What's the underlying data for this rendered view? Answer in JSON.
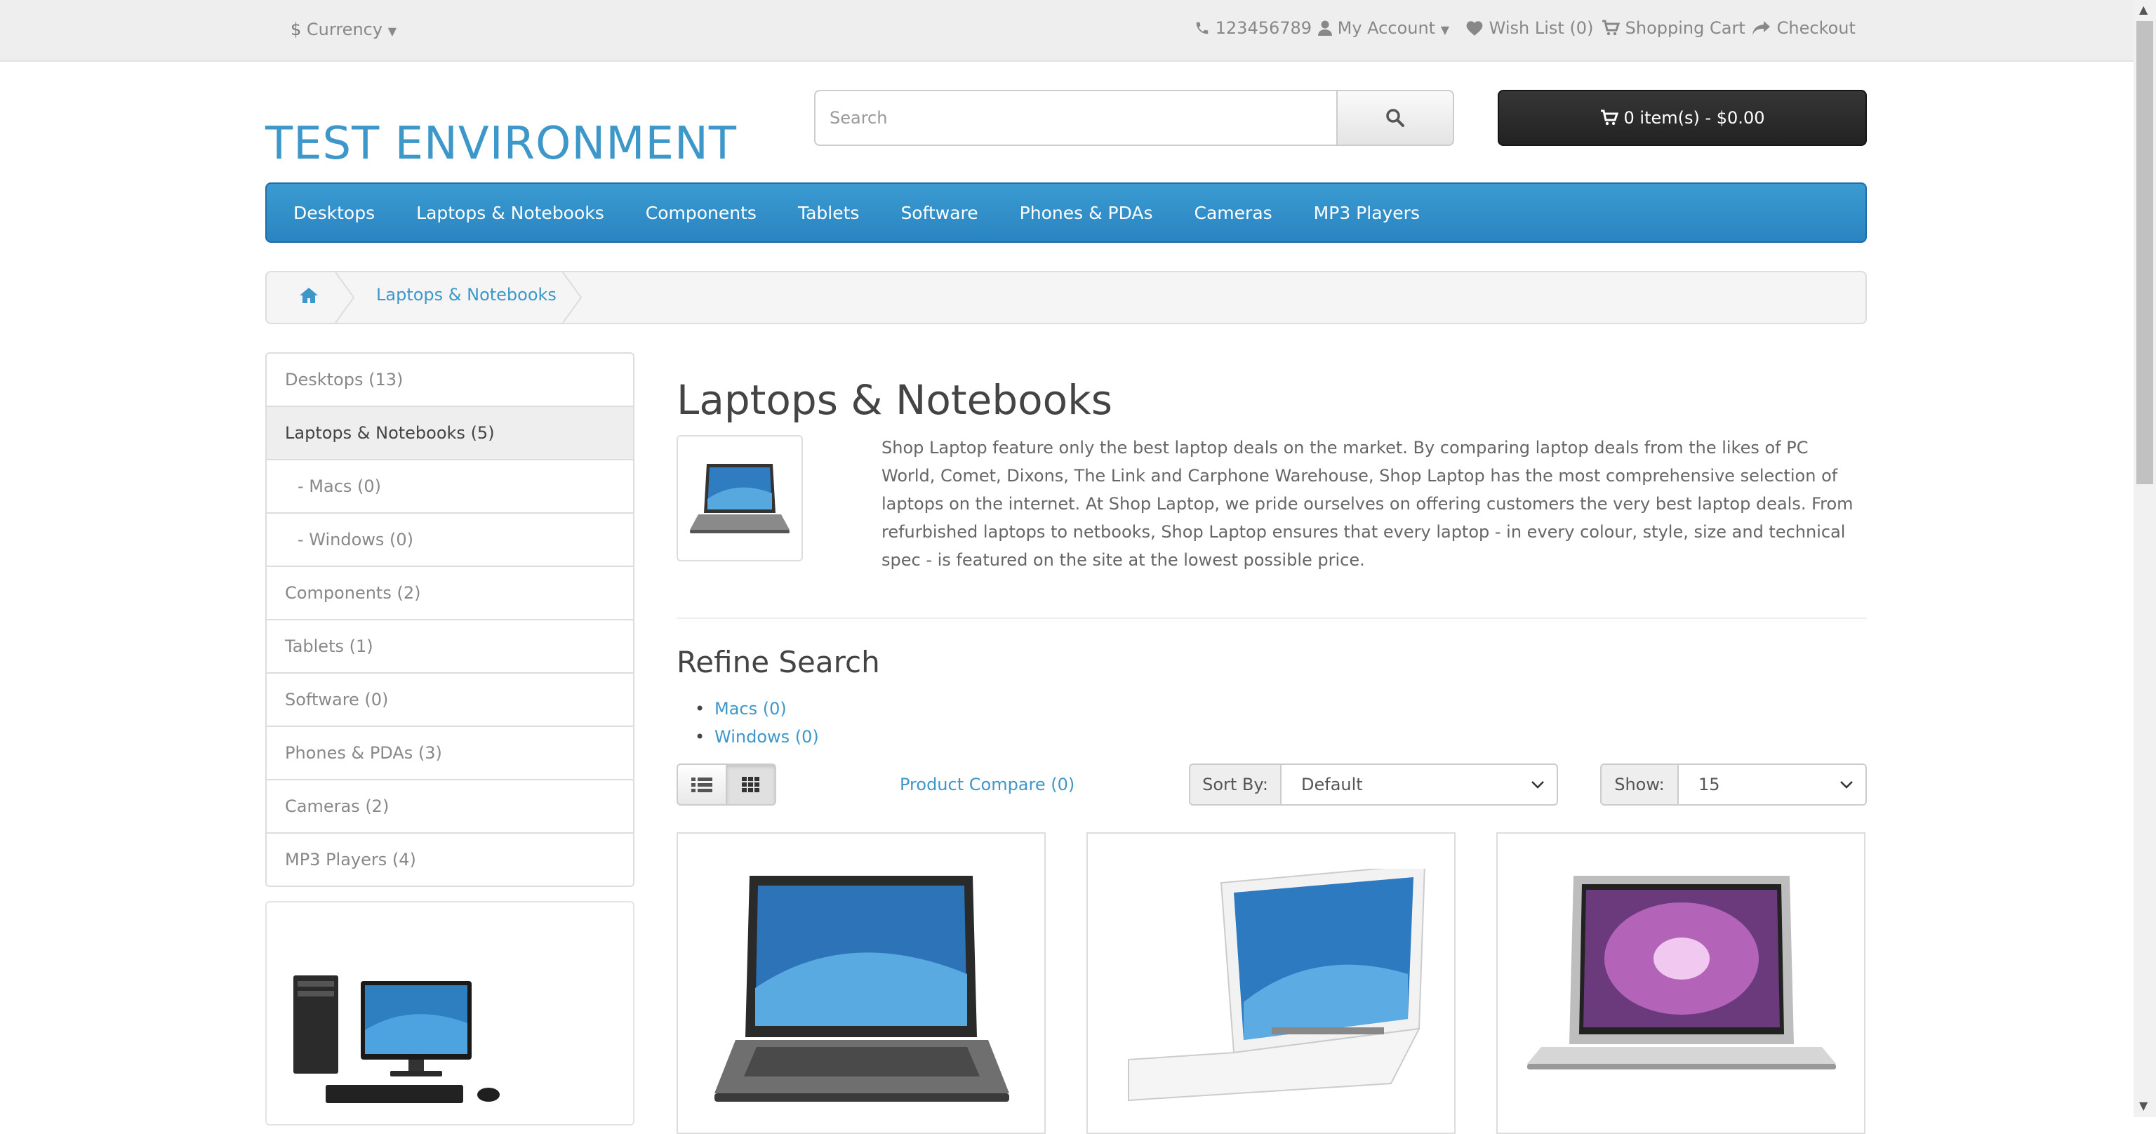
{
  "topbar": {
    "currency": "Currency",
    "currency_symbol": "$",
    "phone": "123456789",
    "my_account": "My Account",
    "wish_list": "Wish List (0)",
    "shopping_cart": "Shopping Cart",
    "checkout": "Checkout"
  },
  "header": {
    "logo": "TEST ENVIRONMENT",
    "search_placeholder": "Search",
    "cart_button": "0 item(s) - $0.00"
  },
  "menu": {
    "items": [
      "Desktops",
      "Laptops & Notebooks",
      "Components",
      "Tablets",
      "Software",
      "Phones & PDAs",
      "Cameras",
      "MP3 Players"
    ]
  },
  "breadcrumb": {
    "current": "Laptops & Notebooks"
  },
  "sidebar": {
    "items": [
      "Desktops (13)",
      "Laptops & Notebooks (5)",
      "- Macs (0)",
      "- Windows (0)",
      "Components (2)",
      "Tablets (1)",
      "Software (0)",
      "Phones & PDAs (3)",
      "Cameras (2)",
      "MP3 Players (4)"
    ]
  },
  "category": {
    "title": "Laptops & Notebooks",
    "description": "Shop Laptop feature only the best laptop deals on the market. By comparing laptop deals from the likes of PC World, Comet, Dixons, The Link and Carphone Warehouse, Shop Laptop has the most comprehensive selection of laptops on the internet. At Shop Laptop, we pride ourselves on offering customers the very best laptop deals. From refurbished laptops to netbooks, Shop Laptop ensures that every laptop - in every colour, style, size and technical spec - is featured on the site at the lowest possible price."
  },
  "refine": {
    "title": "Refine Search",
    "links": [
      "Macs (0)",
      "Windows (0)"
    ]
  },
  "toolbar": {
    "product_compare": "Product Compare (0)",
    "sort_label": "Sort By:",
    "sort_value": "Default",
    "show_label": "Show:",
    "show_value": "15"
  },
  "colors": {
    "accent": "#3d97c9",
    "menu_bg": "#2a84c2",
    "cart_bg": "#222222"
  }
}
